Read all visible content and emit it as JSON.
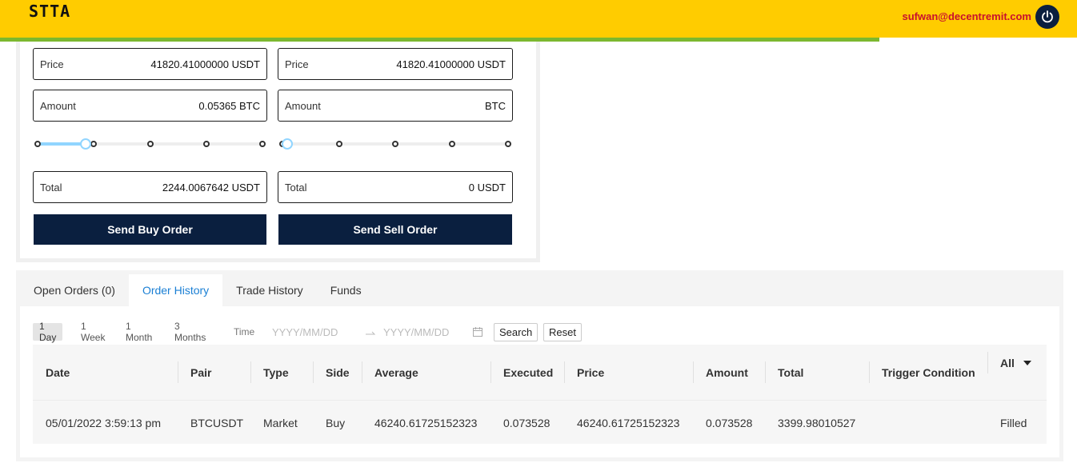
{
  "header": {
    "brand": "STTA",
    "user_email": "sufwan@decentremit.com",
    "brand_color": "#ffcc00",
    "accent_bar_color": "#7cb82f"
  },
  "buy_form": {
    "price_label": "Price",
    "price_value": "41820.41000000 USDT",
    "amount_label": "Amount",
    "amount_value": "0.05365 BTC",
    "slider_percent": 20,
    "total_label": "Total",
    "total_value": "2244.0067642 USDT",
    "submit_label": "Send Buy Order"
  },
  "sell_form": {
    "price_label": "Price",
    "price_value": "41820.41000000 USDT",
    "amount_label": "Amount",
    "amount_value": "BTC",
    "slider_percent": 0,
    "total_label": "Total",
    "total_value": "0 USDT",
    "submit_label": "Send Sell Order"
  },
  "tabs": [
    {
      "label": "Open Orders (0)",
      "active": false
    },
    {
      "label": "Order History",
      "active": true
    },
    {
      "label": "Trade History",
      "active": false
    },
    {
      "label": "Funds",
      "active": false
    }
  ],
  "filters": {
    "ranges": [
      "1 Day",
      "1 Week",
      "1 Month",
      "3 Months"
    ],
    "active_range": "1 Day",
    "time_label": "Time",
    "start_placeholder": "YYYY/MM/DD",
    "end_placeholder": "YYYY/MM/DD",
    "search_label": "Search",
    "reset_label": "Reset"
  },
  "table": {
    "columns": [
      "Date",
      "Pair",
      "Type",
      "Side",
      "Average",
      "Executed",
      "Price",
      "Amount",
      "Total",
      "Trigger Condition",
      "All"
    ],
    "rows": [
      [
        "05/01/2022 3:59:13 pm",
        "BTCUSDT",
        "Market",
        "Buy",
        "46240.61725152323",
        "0.073528",
        "46240.61725152323",
        "0.073528",
        "3399.98010527",
        "",
        "Filled"
      ]
    ]
  }
}
